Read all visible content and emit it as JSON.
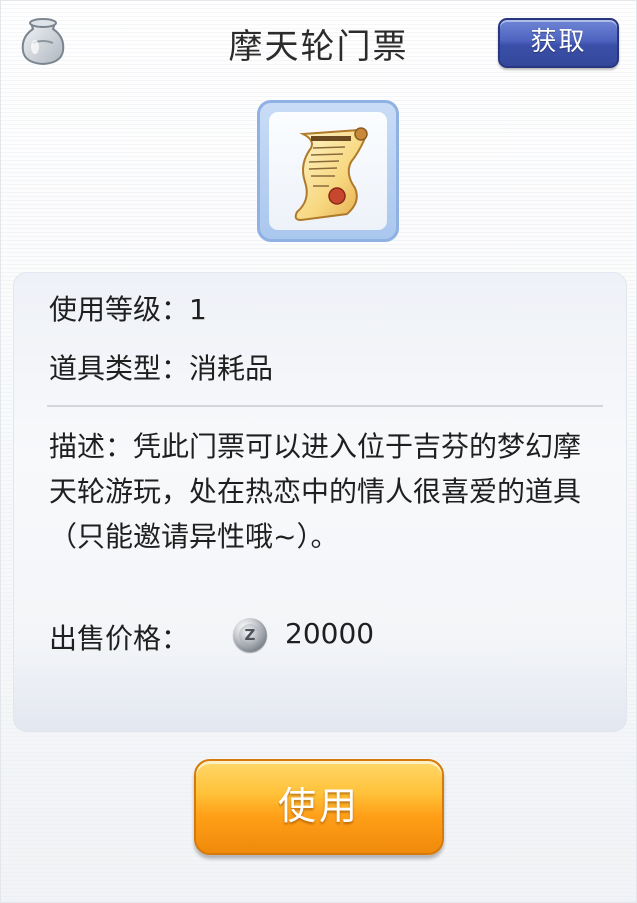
{
  "header": {
    "title": "摩天轮门票",
    "obtain_label": "获取"
  },
  "item": {
    "icon": "scroll-ticket-icon"
  },
  "info": {
    "level_label": "使用等级：",
    "level_value": "1",
    "type_label": "道具类型：",
    "type_value": "消耗品",
    "description": "描述：凭此门票可以进入位于吉芬的梦幻摩天轮游玩，处在热恋中的情人很喜爱的道具（只能邀请异性哦~）。",
    "price_label": "出售价格：",
    "currency_icon": "zeny-coin-icon",
    "currency_symbol": "Z",
    "price_value": "20000"
  },
  "actions": {
    "use_label": "使用"
  },
  "colors": {
    "obtain_button": "#4d63bf",
    "use_button": "#ffb02a",
    "item_frame": "#8fb1e4"
  }
}
